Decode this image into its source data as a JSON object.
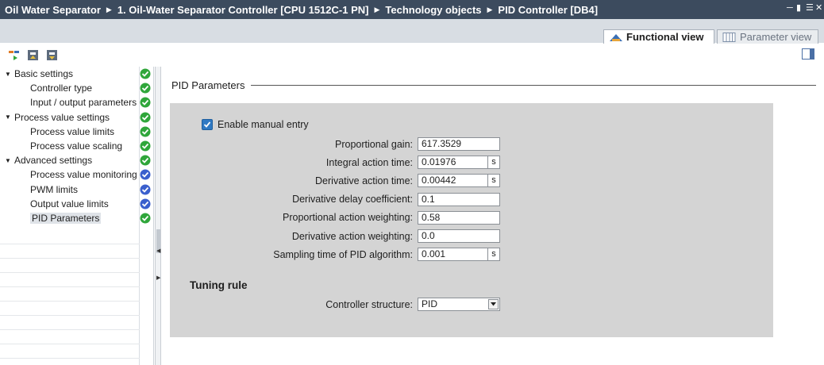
{
  "breadcrumb": {
    "items": [
      "Oil Water Separator",
      "1. Oil-Water Separator Controller [CPU 1512C-1 PN]",
      "Technology objects",
      "PID Controller [DB4]"
    ],
    "separator_icon": "triangle-right"
  },
  "window_controls": [
    "minimize",
    "float",
    "menu",
    "close"
  ],
  "view_tabs": [
    {
      "label": "Functional view",
      "icon": "functional-view-icon",
      "active": true
    },
    {
      "label": "Parameter view",
      "icon": "parameter-view-icon",
      "active": false
    }
  ],
  "toolbar": {
    "buttons": [
      "go-online-icon",
      "upload-icon",
      "download-icon"
    ],
    "right_button": "panel-toggle-icon"
  },
  "tree": {
    "items": [
      {
        "label": "Basic settings",
        "level": 0,
        "expanded": true,
        "status": "ok"
      },
      {
        "label": "Controller type",
        "level": 1,
        "status": "ok"
      },
      {
        "label": "Input / output parameters",
        "level": 1,
        "status": "ok"
      },
      {
        "label": "Process value settings",
        "level": 0,
        "expanded": true,
        "status": "ok"
      },
      {
        "label": "Process value limits",
        "level": 1,
        "status": "ok"
      },
      {
        "label": "Process value scaling",
        "level": 1,
        "status": "ok"
      },
      {
        "label": "Advanced settings",
        "level": 0,
        "expanded": true,
        "status": "ok"
      },
      {
        "label": "Process value monitoring",
        "level": 1,
        "status": "default"
      },
      {
        "label": "PWM limits",
        "level": 1,
        "status": "default"
      },
      {
        "label": "Output value limits",
        "level": 1,
        "status": "default"
      },
      {
        "label": "PID Parameters",
        "level": 1,
        "status": "ok",
        "selected": true
      }
    ]
  },
  "section": {
    "title": "PID Parameters",
    "enable_manual_entry": {
      "label": "Enable manual entry",
      "checked": true
    },
    "fields": [
      {
        "label": "Proportional gain:",
        "value": "617.3529",
        "unit": ""
      },
      {
        "label": "Integral action time:",
        "value": "0.01976",
        "unit": "s"
      },
      {
        "label": "Derivative action time:",
        "value": "0.00442",
        "unit": "s"
      },
      {
        "label": "Derivative delay coefficient:",
        "value": "0.1",
        "unit": ""
      },
      {
        "label": "Proportional action weighting:",
        "value": "0.58",
        "unit": ""
      },
      {
        "label": "Derivative action weighting:",
        "value": "0.0",
        "unit": ""
      },
      {
        "label": "Sampling time of PID algorithm:",
        "value": "0.001",
        "unit": "s"
      }
    ],
    "tuning_rule": {
      "title": "Tuning rule",
      "controller_structure_label": "Controller structure:",
      "controller_structure_value": "PID"
    }
  },
  "colors": {
    "titlebar": "#3c4b5e",
    "status_ok": "#2fa63a",
    "status_default": "#3a5fcd",
    "panel": "#d4d4d4",
    "checkbox": "#2f79c3"
  }
}
